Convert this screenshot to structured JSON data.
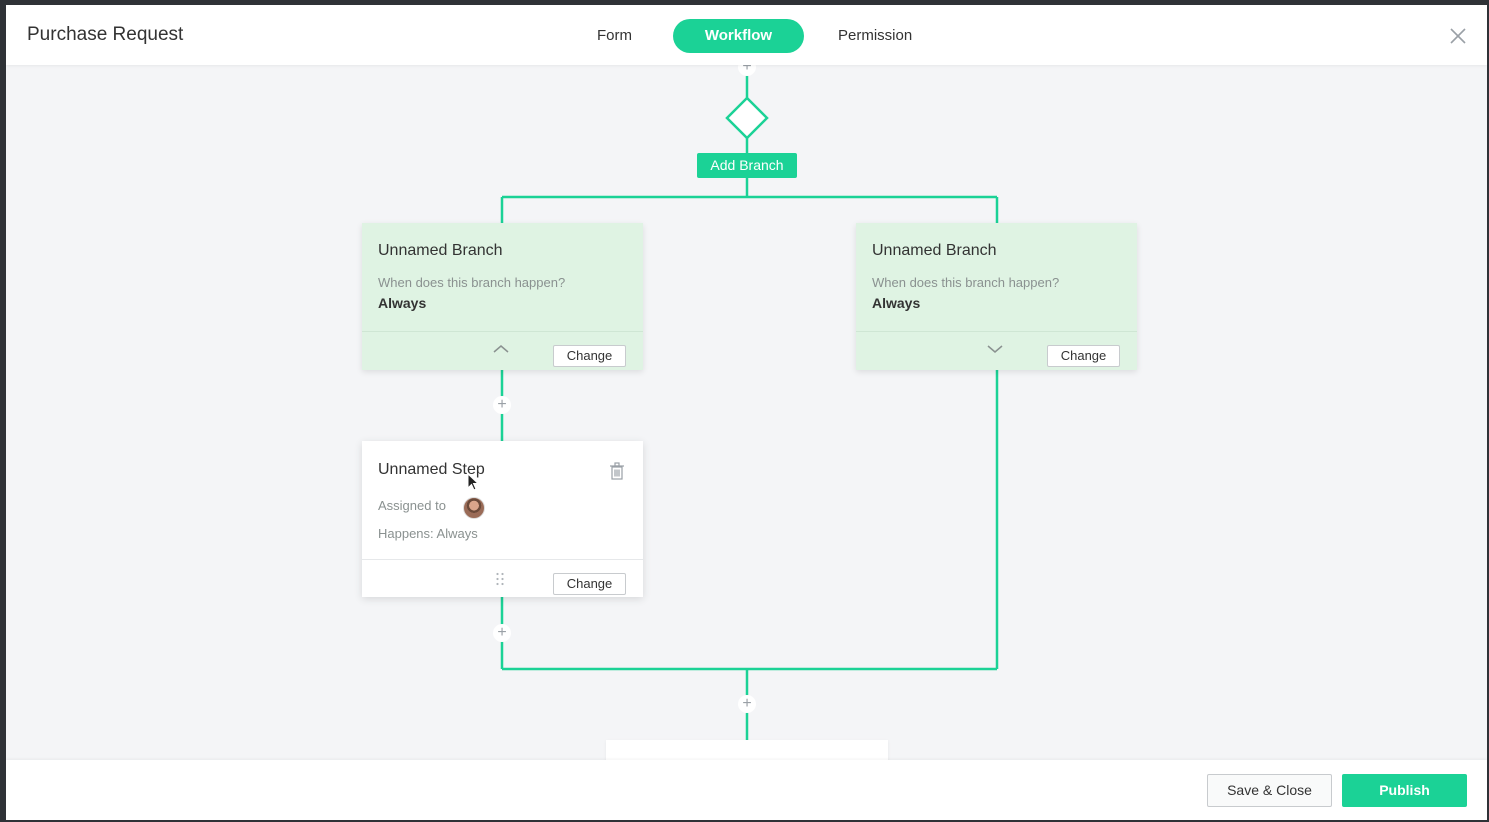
{
  "header": {
    "title": "Purchase Request",
    "tabs": [
      {
        "label": "Form",
        "active": false
      },
      {
        "label": "Workflow",
        "active": true
      },
      {
        "label": "Permission",
        "active": false
      }
    ]
  },
  "workflow": {
    "add_branch_label": "Add Branch",
    "branches": [
      {
        "title": "Unnamed Branch",
        "question": "When does this branch happen?",
        "condition": "Always",
        "change_label": "Change",
        "toggle": "collapse"
      },
      {
        "title": "Unnamed Branch",
        "question": "When does this branch happen?",
        "condition": "Always",
        "change_label": "Change",
        "toggle": "expand"
      }
    ],
    "step": {
      "title": "Unnamed Step",
      "assigned_label": "Assigned to",
      "happens_label": "Happens: Always",
      "change_label": "Change"
    }
  },
  "footer": {
    "save_close_label": "Save & Close",
    "publish_label": "Publish"
  },
  "colors": {
    "accent": "#1bd296",
    "branch_bg": "#dff3e3",
    "canvas_bg": "#f4f5f7"
  }
}
